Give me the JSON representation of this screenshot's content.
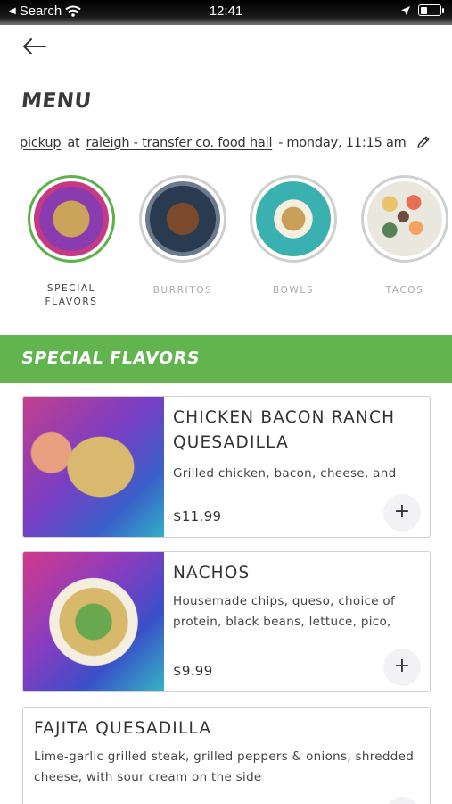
{
  "status_bar": {
    "back_app": "Search",
    "time": "12:41",
    "battery_level": 0.35
  },
  "page": {
    "title": "MENU"
  },
  "order_info": {
    "mode": "pickup",
    "at": "at",
    "location": "raleigh - transfer co. food hall",
    "separator": "-",
    "datetime": "monday, 11:15 am"
  },
  "categories": [
    {
      "label": "SPECIAL FLAVORS",
      "active": true
    },
    {
      "label": "BURRITOS",
      "active": false
    },
    {
      "label": "BOWLS",
      "active": false
    },
    {
      "label": "TACOS",
      "active": false
    }
  ],
  "section": {
    "title": "SPECIAL FLAVORS"
  },
  "items": [
    {
      "name": "CHICKEN BACON RANCH QUESADILLA",
      "description": "Grilled chicken, bacon, cheese, and",
      "price": "$11.99",
      "add_label": "+"
    },
    {
      "name": "NACHOS",
      "description": "Housemade chips, queso, choice of protein, black beans, lettuce, pico,",
      "price": "$9.99",
      "add_label": "+"
    },
    {
      "name": "FAJITA QUESADILLA",
      "description": "Lime-garlic grilled steak, grilled peppers & onions, shredded cheese, with sour cream on the side"
    }
  ]
}
